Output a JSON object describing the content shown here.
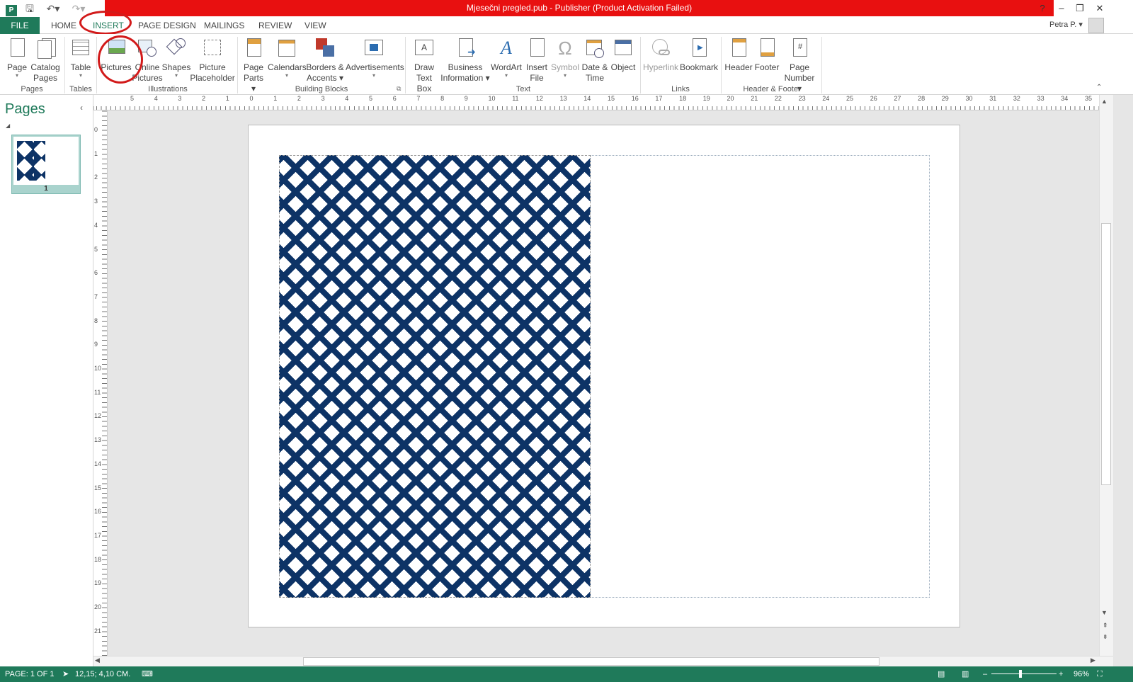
{
  "window": {
    "title": "Mjesečni pregled.pub -  Publisher (Product Activation Failed)",
    "help": "?",
    "user": "Petra P.",
    "user_caret": "▾"
  },
  "quick_access": {
    "app_icon": "publisher-app-icon",
    "save_icon": "save-icon",
    "undo_icon": "undo-icon",
    "redo_icon": "redo-icon"
  },
  "tabs": {
    "file": "FILE",
    "home": "HOME",
    "insert": "INSERT",
    "page_design": "PAGE DESIGN",
    "mailings": "MAILINGS",
    "review": "REVIEW",
    "view": "VIEW"
  },
  "ribbon": {
    "pages_group": "Pages",
    "tables_group": "Tables",
    "illustrations_group": "Illustrations",
    "building_blocks_group": "Building Blocks",
    "text_group": "Text",
    "links_group": "Links",
    "header_footer_group": "Header & Footer",
    "page": "Page",
    "catalog_pages_1": "Catalog",
    "catalog_pages_2": "Pages",
    "table": "Table",
    "pictures": "Pictures",
    "online_pictures_1": "Online",
    "online_pictures_2": "Pictures",
    "shapes": "Shapes",
    "picture_placeholder_1": "Picture",
    "picture_placeholder_2": "Placeholder",
    "page_parts_1": "Page",
    "page_parts_2": "Parts",
    "calendars": "Calendars",
    "borders_1": "Borders &",
    "borders_2": "Accents",
    "advertisements": "Advertisements",
    "draw_text_box_1": "Draw",
    "draw_text_box_2": "Text Box",
    "business_info_1": "Business",
    "business_info_2": "Information",
    "wordart": "WordArt",
    "insert_file_1": "Insert",
    "insert_file_2": "File",
    "symbol": "Symbol",
    "date_time_1": "Date &",
    "date_time_2": "Time",
    "object": "Object",
    "hyperlink": "Hyperlink",
    "bookmark": "Bookmark",
    "header": "Header",
    "footer": "Footer",
    "page_number_1": "Page",
    "page_number_2": "Number"
  },
  "pages_pane": {
    "title": "Pages",
    "thumb_number": "1"
  },
  "ruler": {
    "top_labels": [
      "5",
      "4",
      "3",
      "2",
      "1",
      "0",
      "1",
      "2",
      "3",
      "4",
      "5",
      "6",
      "7",
      "8",
      "9",
      "10",
      "11",
      "12",
      "13",
      "14",
      "15",
      "16",
      "17",
      "18",
      "19",
      "20",
      "21",
      "22",
      "23",
      "24",
      "25",
      "26",
      "27",
      "28",
      "29",
      "30",
      "31",
      "32",
      "33",
      "34",
      "35"
    ],
    "left_labels": [
      "0",
      "1",
      "2",
      "3",
      "4",
      "5",
      "6",
      "7",
      "8",
      "9",
      "10",
      "11",
      "12",
      "13",
      "14",
      "15",
      "16",
      "17",
      "18",
      "19",
      "20",
      "21"
    ]
  },
  "status": {
    "page": "PAGE: 1 OF 1",
    "position": "12,15; 4,10 CM.",
    "zoom": "96%"
  },
  "colors": {
    "title_red": "#e81010",
    "accent_green": "#1f7a5a",
    "chevron_navy": "#0d3366",
    "annotation_red": "#d21a1a"
  }
}
